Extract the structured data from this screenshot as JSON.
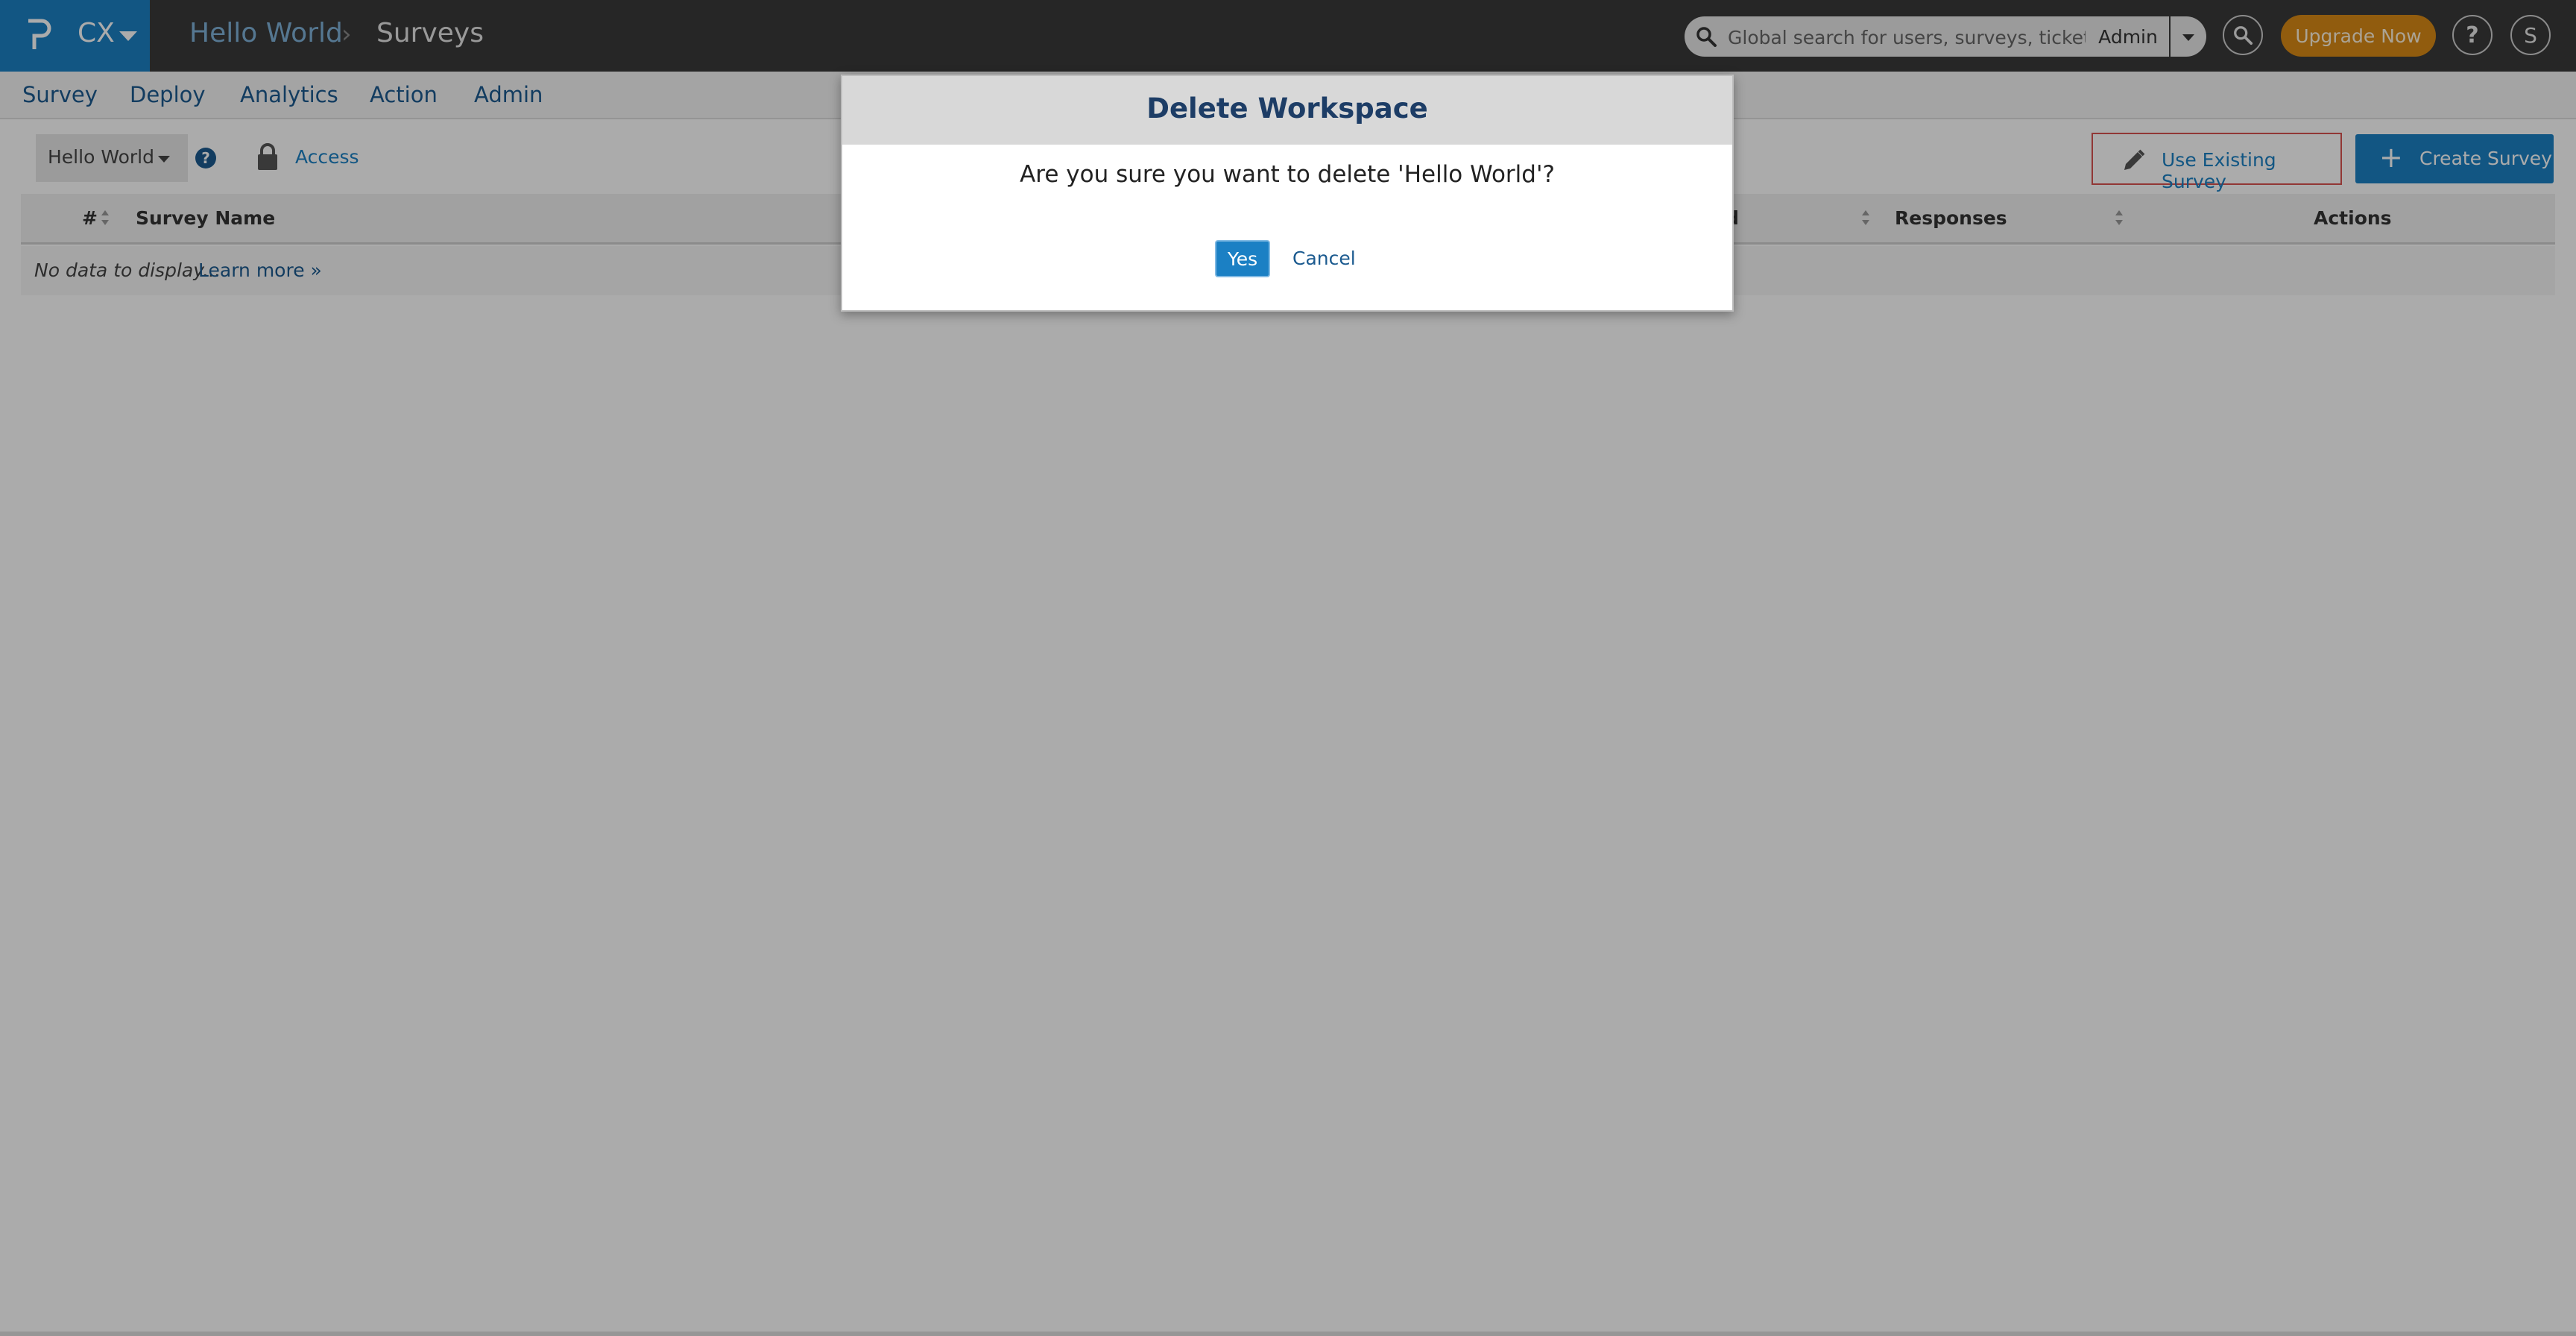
{
  "header": {
    "product_name": "CX",
    "workspace": "Hello World",
    "breadcrumb_separator": "›",
    "page_title": "Surveys",
    "search_placeholder": "Global search for users, surveys, tickets",
    "search_scope": "Admin",
    "upgrade_label": "Upgrade Now",
    "help_label": "?",
    "user_initial": "S"
  },
  "nav": {
    "items": [
      {
        "label": "Survey"
      },
      {
        "label": "Deploy"
      },
      {
        "label": "Analytics"
      },
      {
        "label": "Action"
      },
      {
        "label": "Admin"
      }
    ]
  },
  "toolbar": {
    "workspace_select": "Hello World",
    "help_mini": "?",
    "access_label": "Access",
    "use_existing_label": "Use Existing Survey",
    "create_label": "Create Survey",
    "create_plus": "+"
  },
  "table": {
    "columns": [
      {
        "label": "#"
      },
      {
        "label": "Survey Name"
      },
      {
        "label": "ed"
      },
      {
        "label": "Responses"
      },
      {
        "label": "Actions"
      }
    ],
    "empty_text": "No data to display...",
    "learn_more": "Learn more »"
  },
  "modal": {
    "title": "Delete Workspace",
    "message": "Are you sure you want to delete 'Hello World'?",
    "yes_label": "Yes",
    "cancel_label": "Cancel"
  },
  "colors": {
    "brand_blue": "#1b80c4",
    "header_dark": "#3a3a3a",
    "upgrade_orange": "#d98a16",
    "highlight_red": "#d9534f"
  },
  "icons": [
    "logo-icon",
    "caret-down-icon",
    "search-icon",
    "help-icon",
    "lock-icon",
    "pencil-icon",
    "plus-icon",
    "sort-icon"
  ]
}
